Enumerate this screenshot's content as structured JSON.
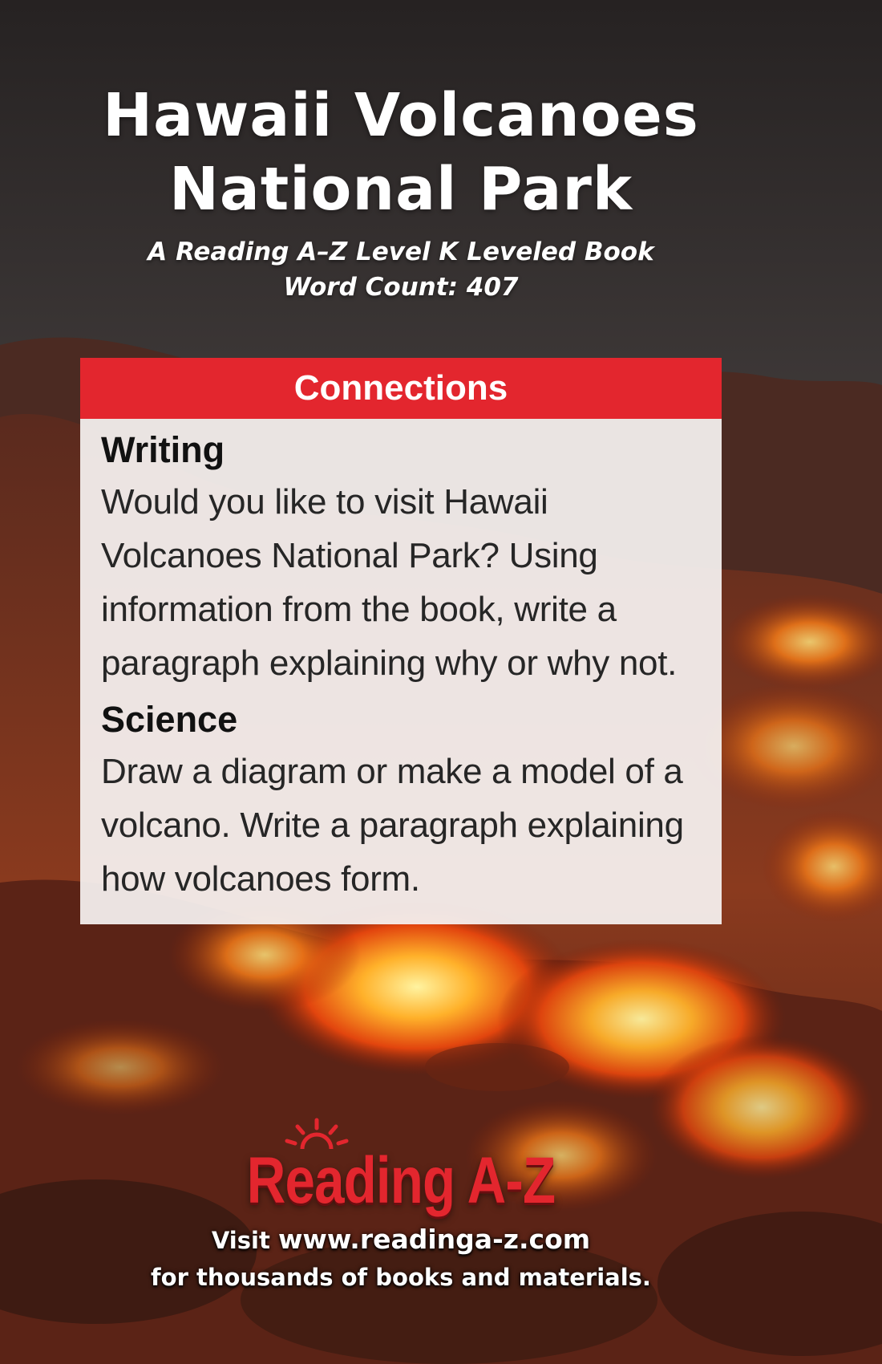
{
  "cover": {
    "title_line1": "Hawaii Volcanoes",
    "title_line2": "National Park",
    "subtitle_line1": "A Reading A–Z Level K Leveled Book",
    "subtitle_line2": "Word Count: 407"
  },
  "connections": {
    "header": "Connections",
    "sections": [
      {
        "heading": "Writing",
        "text": "Would you like to visit Hawaii Volcanoes National Park? Using information from the book, write a paragraph explaining why or why not."
      },
      {
        "heading": "Science",
        "text": "Draw a diagram or make a model of a volcano. Write a paragraph explaining how volcanoes form."
      }
    ]
  },
  "footer": {
    "logo_text": "Reading A-Z",
    "visit_prefix": "Visit",
    "url": "www.readinga-z.com",
    "tagline": "for thousands of books and materials."
  },
  "colors": {
    "accent_red": "#e3262e",
    "panel_bg": "#f6f2f1",
    "lava_bright": "#ffb12a",
    "lava_deep": "#c8320c",
    "sky": "#3a3534"
  },
  "icons": {
    "logo_sun": "sun-icon"
  }
}
